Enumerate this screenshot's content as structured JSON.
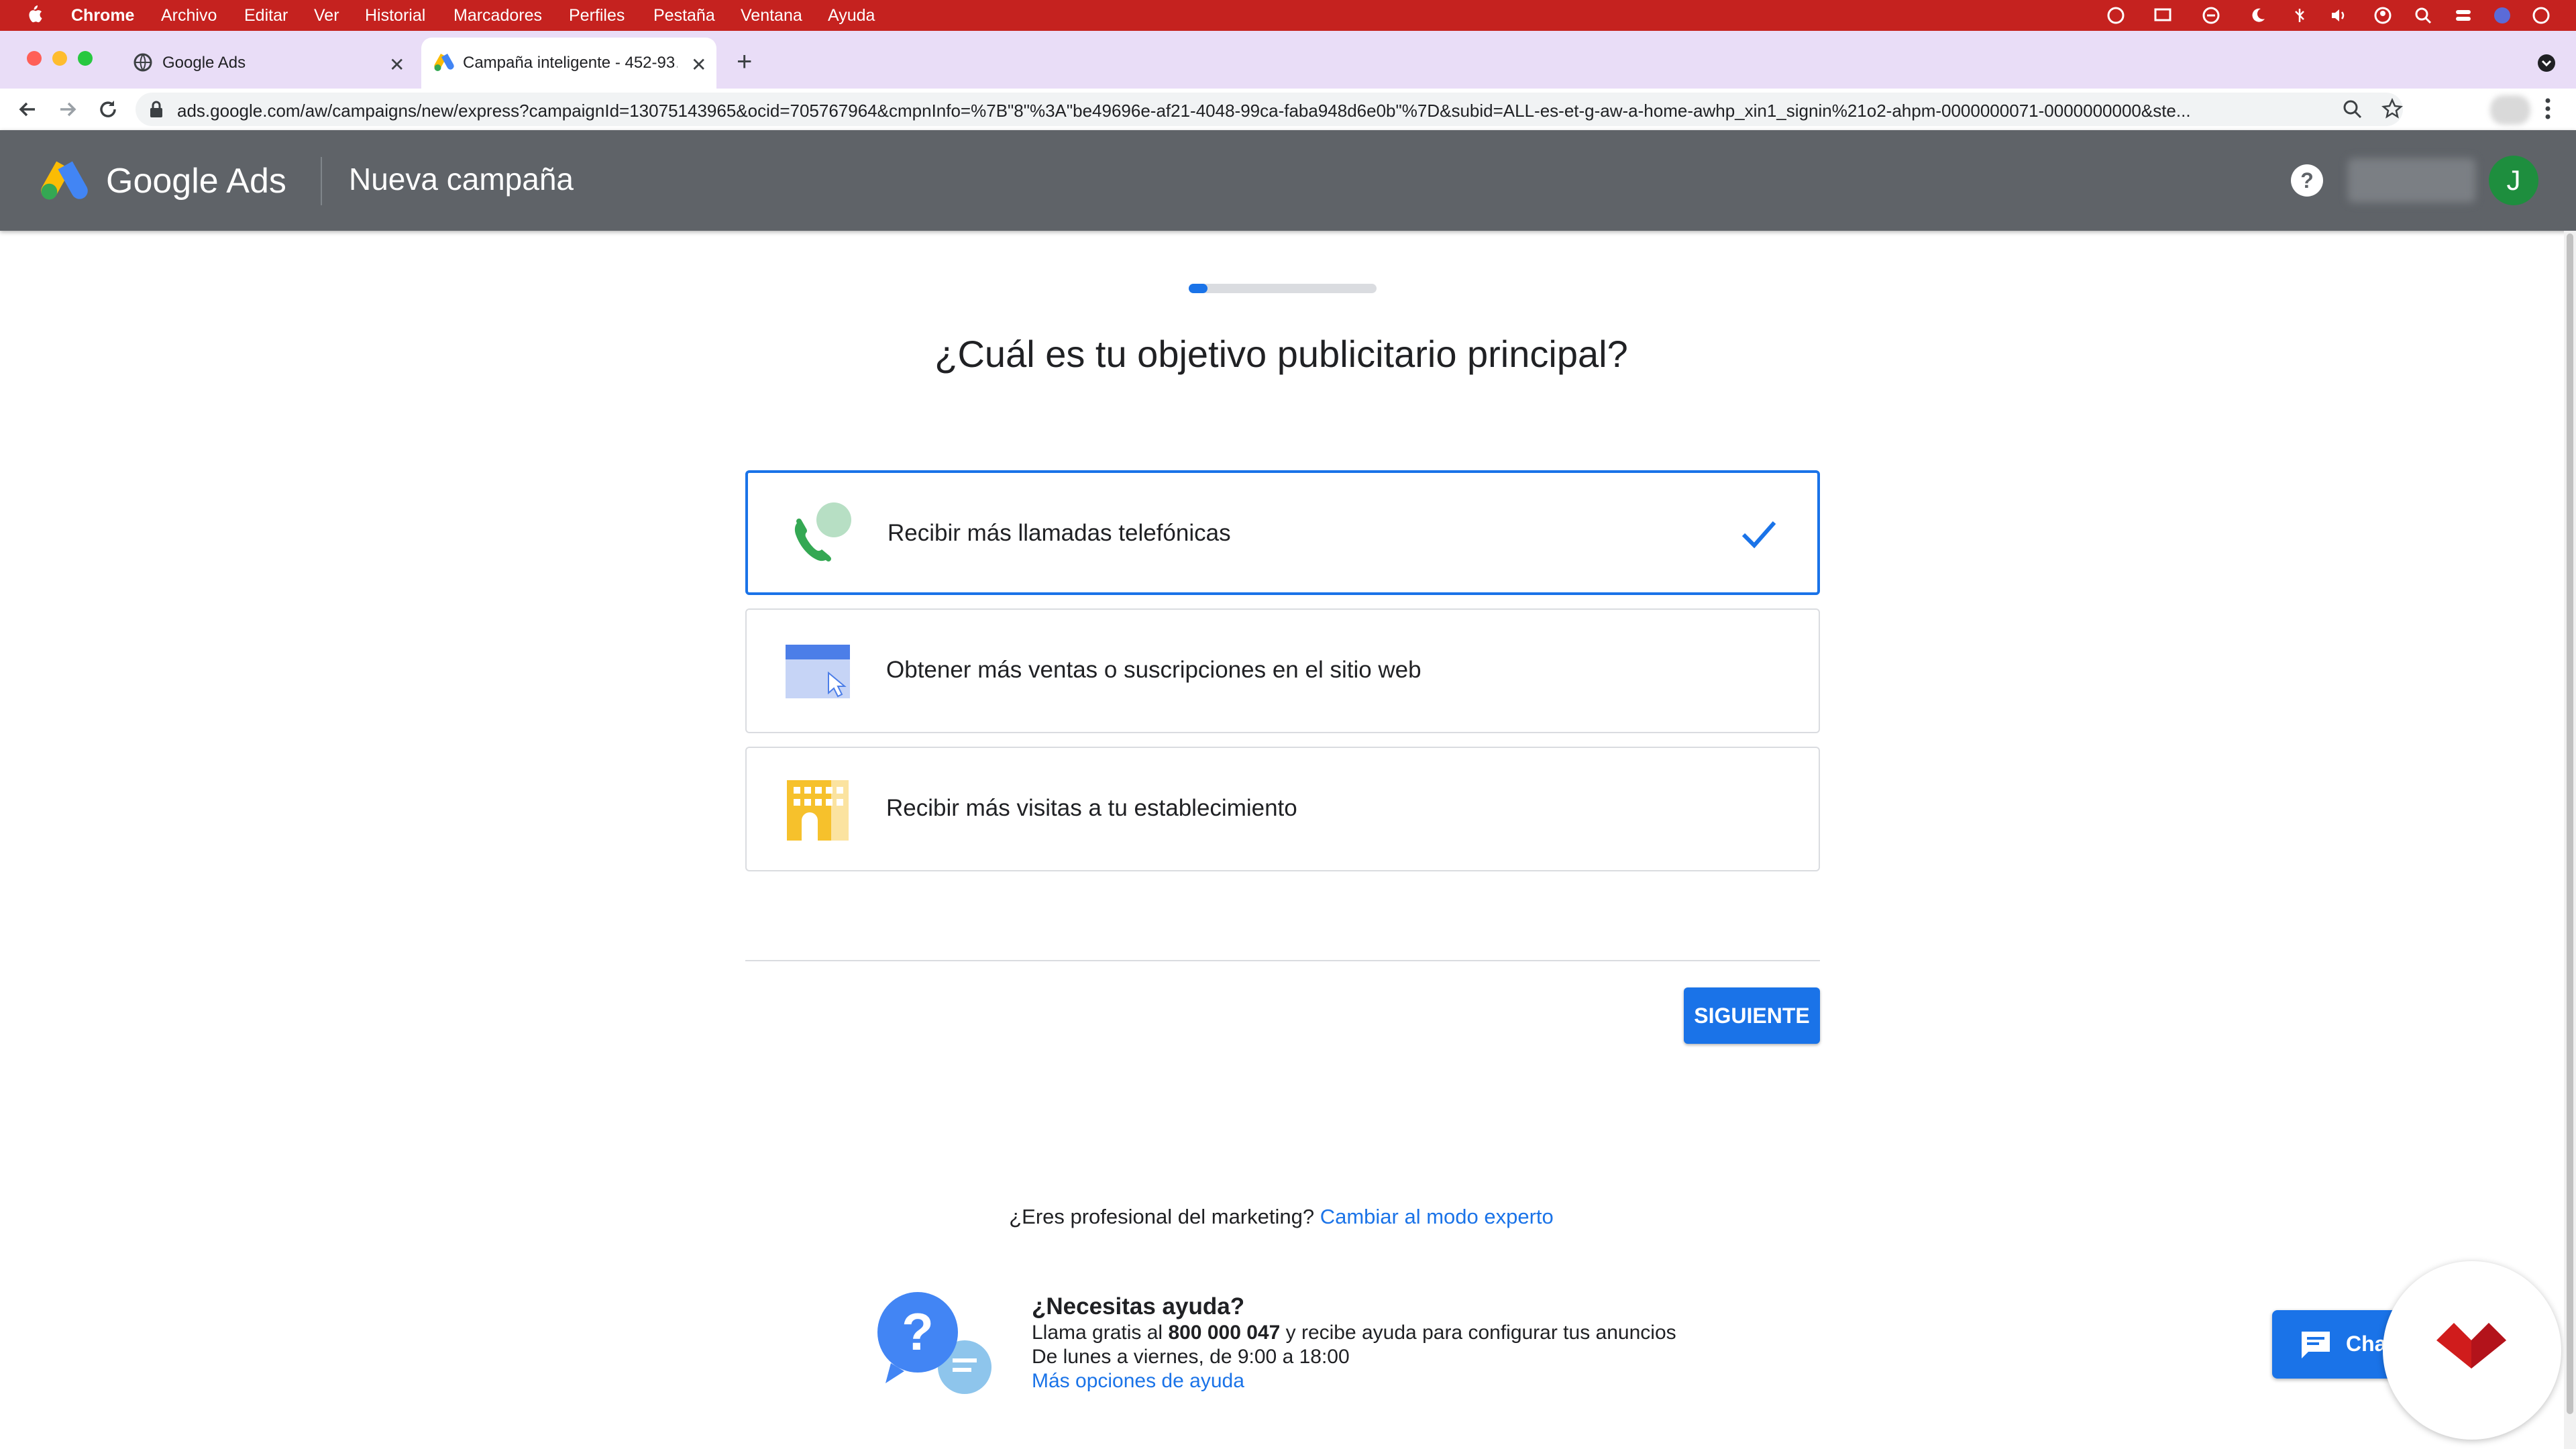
{
  "menubar": {
    "app_name": "Chrome",
    "items": [
      "Archivo",
      "Editar",
      "Ver",
      "Historial",
      "Marcadores",
      "Perfiles",
      "Pestaña",
      "Ventana",
      "Ayuda"
    ]
  },
  "tabs": [
    {
      "title": "Google Ads",
      "icon": "globe-icon",
      "active": false
    },
    {
      "title": "Campaña inteligente - 452-93…",
      "icon": "google-ads-logo-icon",
      "active": true
    }
  ],
  "address_bar": {
    "url": "ads.google.com/aw/campaigns/new/express?campaignId=13075143965&ocid=705767964&cmpnInfo=%7B\"8\"%3A\"be49696e-af21-4048-99ca-faba948d6e0b\"%7D&subid=ALL-es-et-g-aw-a-home-awhp_xin1_signin%21o2-ahpm-0000000071-0000000000&ste..."
  },
  "header": {
    "brand": "Google Ads",
    "page_title": "Nueva campaña",
    "avatar_initial": "J"
  },
  "wizard": {
    "progress": 0.1,
    "question": "¿Cuál es tu objetivo publicitario principal?",
    "options": [
      {
        "label": "Recibir más llamadas telefónicas",
        "icon": "phone-icon",
        "selected": true
      },
      {
        "label": "Obtener más ventas o suscripciones en el sitio web",
        "icon": "website-cursor-icon",
        "selected": false
      },
      {
        "label": "Recibir más visitas a tu establecimiento",
        "icon": "building-icon",
        "selected": false
      }
    ],
    "next_label": "SIGUIENTE"
  },
  "marketing": {
    "prompt": "¿Eres profesional del marketing?",
    "link": "Cambiar al modo experto"
  },
  "help": {
    "title": "¿Necesitas ayuda?",
    "line1_pre": "Llama gratis al ",
    "phone": "800 000 047",
    "line1_post": " y recibe ayuda para configurar tus anuncios",
    "line2": "De lunes a viernes, de 9:00 a 18:00",
    "link": "Más opciones de ayuda"
  },
  "chat": {
    "label": "Cha"
  },
  "colors": {
    "accent": "#1a73e8",
    "menubar": "#c5221f",
    "header": "#5f6368",
    "tabstrip": "#e9ddf7"
  }
}
